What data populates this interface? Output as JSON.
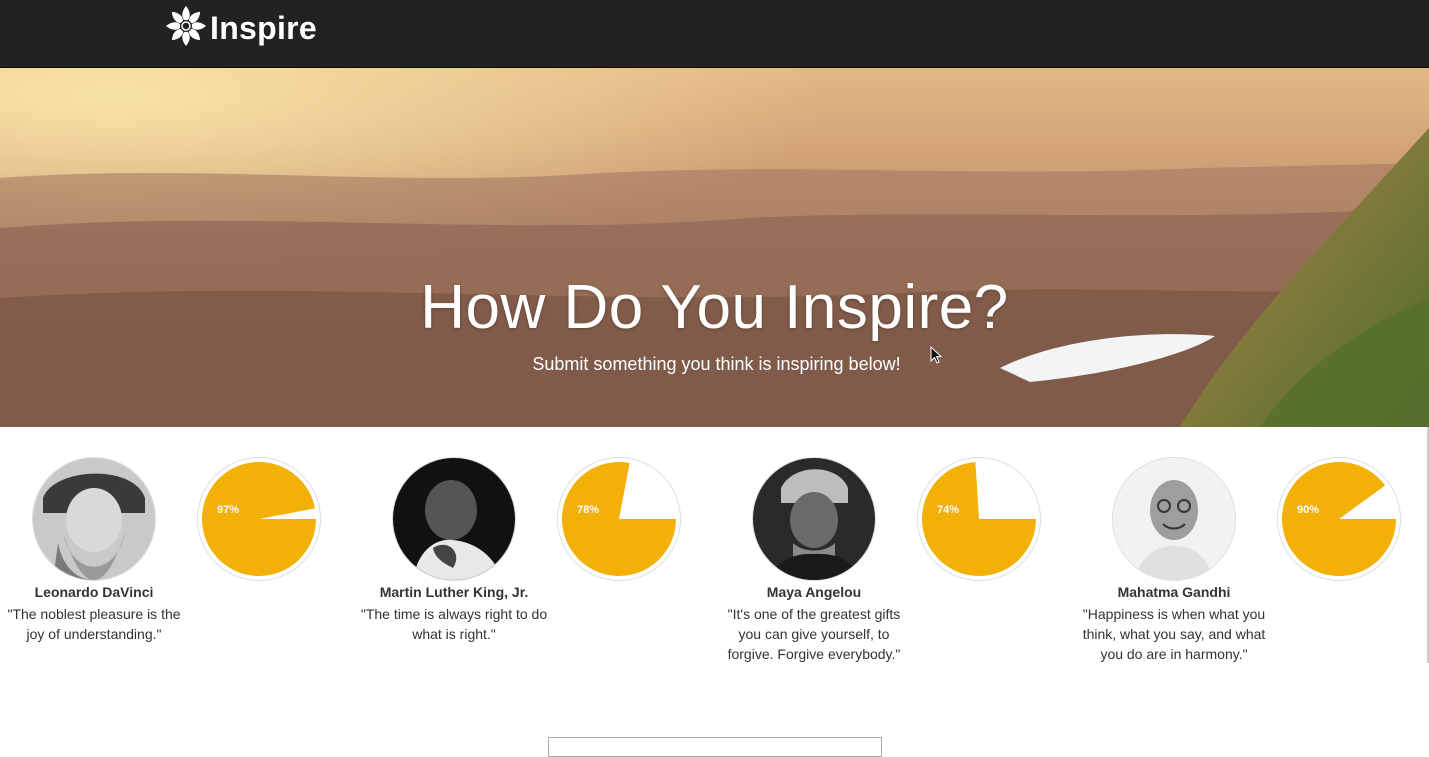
{
  "nav": {
    "brand": "Inspire",
    "brand_icon": "flower-logo-icon"
  },
  "hero": {
    "title": "How Do You Inspire?",
    "subtitle": "Submit something you think is inspiring below!"
  },
  "accent_color": "#f3b006",
  "people": [
    {
      "name": "Leonardo DaVinci",
      "quote": "\"The noblest pleasure is the joy of understanding.\"",
      "percent_label": "97%",
      "percent": 0.97
    },
    {
      "name": "Martin Luther King, Jr.",
      "quote": "\"The time is always right to do what is right.\"",
      "percent_label": "78%",
      "percent": 0.78
    },
    {
      "name": "Maya Angelou",
      "quote": "\"It's one of the greatest gifts you can give yourself, to forgive. Forgive everybody.\"",
      "percent_label": "74%",
      "percent": 0.74
    },
    {
      "name": "Mahatma Gandhi",
      "quote": "\"Happiness is when what you think, what you say, and what you do are in harmony.\"",
      "percent_label": "90%",
      "percent": 0.9
    }
  ]
}
